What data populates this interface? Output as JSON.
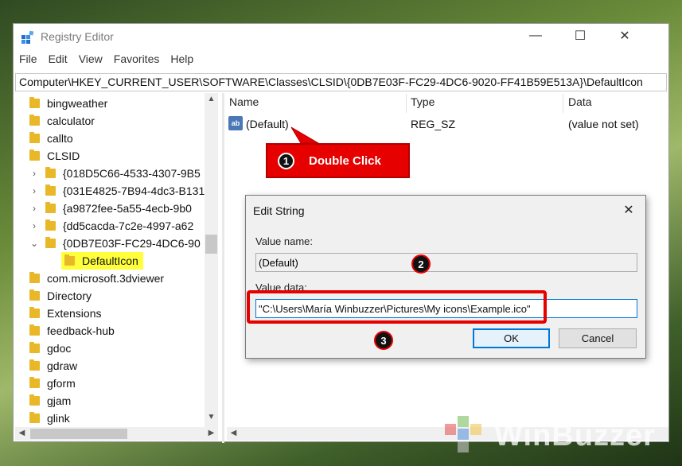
{
  "window": {
    "title": "Registry Editor",
    "controls": {
      "minimize": "—",
      "maximize": "☐",
      "close": "✕"
    }
  },
  "menu": [
    "File",
    "Edit",
    "View",
    "Favorites",
    "Help"
  ],
  "address": "Computer\\HKEY_CURRENT_USER\\SOFTWARE\\Classes\\CLSID\\{0DB7E03F-FC29-4DC6-9020-FF41B59E513A}\\DefaultIcon",
  "tree": [
    {
      "label": "bingweather",
      "level": 0,
      "chevron": ""
    },
    {
      "label": "calculator",
      "level": 0,
      "chevron": ""
    },
    {
      "label": "callto",
      "level": 0,
      "chevron": ""
    },
    {
      "label": "CLSID",
      "level": 0,
      "chevron": ""
    },
    {
      "label": "{018D5C66-4533-4307-9B5",
      "level": 1,
      "chevron": "›"
    },
    {
      "label": "{031E4825-7B94-4dc3-B131",
      "level": 1,
      "chevron": "›"
    },
    {
      "label": "{a9872fee-5a55-4ecb-9b0",
      "level": 1,
      "chevron": "›"
    },
    {
      "label": "{dd5cacda-7c2e-4997-a62",
      "level": 1,
      "chevron": "›"
    },
    {
      "label": "{0DB7E03F-FC29-4DC6-90",
      "level": 1,
      "chevron": "⌄"
    },
    {
      "label": "DefaultIcon",
      "level": 2,
      "chevron": ""
    },
    {
      "label": "com.microsoft.3dviewer",
      "level": 0,
      "chevron": ""
    },
    {
      "label": "Directory",
      "level": 0,
      "chevron": ""
    },
    {
      "label": "Extensions",
      "level": 0,
      "chevron": ""
    },
    {
      "label": "feedback-hub",
      "level": 0,
      "chevron": ""
    },
    {
      "label": "gdoc",
      "level": 0,
      "chevron": ""
    },
    {
      "label": "gdraw",
      "level": 0,
      "chevron": ""
    },
    {
      "label": "gform",
      "level": 0,
      "chevron": ""
    },
    {
      "label": "gjam",
      "level": 0,
      "chevron": ""
    },
    {
      "label": "glink",
      "level": 0,
      "chevron": ""
    }
  ],
  "list": {
    "headers": {
      "name": "Name",
      "type": "Type",
      "data": "Data"
    },
    "rows": [
      {
        "icon": "ab",
        "name": "(Default)",
        "type": "REG_SZ",
        "data": "(value not set)"
      }
    ]
  },
  "dialog": {
    "title": "Edit String",
    "close": "✕",
    "value_name_label": "Value name:",
    "value_name": "(Default)",
    "value_data_label": "Value data:",
    "value_data": "\"C:\\Users\\María Winbuzzer\\Pictures\\My icons\\Example.ico\"",
    "ok": "OK",
    "cancel": "Cancel"
  },
  "annotations": {
    "step1": {
      "number": "1",
      "text": "Double Click"
    },
    "step2": {
      "number": "2"
    },
    "step3": {
      "number": "3"
    },
    "color": "#e60000"
  },
  "watermark": "WinBuzzer"
}
